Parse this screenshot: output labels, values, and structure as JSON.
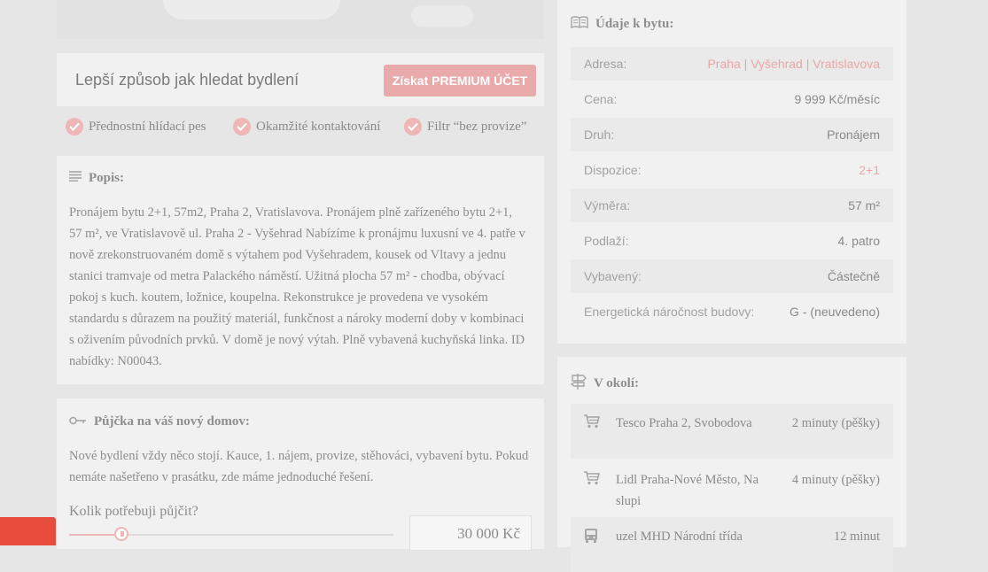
{
  "premium": {
    "title": "Lepší způsob jak hledat bydlení",
    "button": "Získat PREMIUM ÚČET",
    "features": [
      "Přednostní hlídací pes",
      "Okamžité kontaktování",
      "Filtr “bez provize”"
    ]
  },
  "popis": {
    "heading": "Popis:",
    "text": "Pronájem bytu 2+1, 57m2, Praha 2, Vratislavova. Pronájem plně zařízeného bytu 2+1, 57 m², ve Vratislavově ul. Praha 2 - Vyšehrad Nabízíme k pronájmu luxusní ve 4. patře v nově zrekonstruovaném domě s výtahem pod Vyšehradem, kousek od Vltavy a jednu stanici tramvaje od metra Palackého náměstí. Užitná plocha 57 m² - chodba, obývací pokoj s kuch. koutem, ložnice, koupelna. Rekonstrukce je provedena ve vysokém standardu s důrazem na použitý materiál, funkčnost a nároky moderní doby v kombinaci s oživením původních prvků. V domě je nový výtah. Plně vybavená kuchyňská linka. ID nabídky: N00043."
  },
  "loan": {
    "heading": "Půjčka na váš nový domov:",
    "text": "Nové bydlení vždy něco stojí. Kauce, 1. nájem, provize, stěhováci, vybavení bytu. Pokud nemáte našetřeno v prasátku, zde máme jednoduché řešení.",
    "question": "Kolik potřebuji půjčit?",
    "amount": "30 000 Kč",
    "slider_fraction": 0.16
  },
  "udaje": {
    "heading": "Údaje k bytu:",
    "rows": [
      {
        "label": "Adresa:",
        "value": "Praha | Vyšehrad | Vratislavova"
      },
      {
        "label": "Cena:",
        "value": "9 999 Kč/měsíc"
      },
      {
        "label": "Druh:",
        "value": "Pronájem"
      },
      {
        "label": "Dispozice:",
        "value": "2+1"
      },
      {
        "label": "Výměra:",
        "value": "57 m²"
      },
      {
        "label": "Podlaží:",
        "value": "4. patro"
      },
      {
        "label": "Vybavený:",
        "value": "Částečně"
      },
      {
        "label": "Energetická náročnost budovy:",
        "value": "G - (neuvedeno)"
      }
    ]
  },
  "okoli": {
    "heading": "V okolí:",
    "items": [
      {
        "icon": "cart-icon",
        "name": "Tesco Praha 2, Svobodova",
        "time": "2 minuty (pěšky)"
      },
      {
        "icon": "cart-icon",
        "name": "Lidl Praha-Nové Město, Na slupi",
        "time": "4 minuty (pěšky)"
      },
      {
        "icon": "bus-icon",
        "name": "uzel MHD Národní třída",
        "time": "12 minut"
      }
    ]
  },
  "colors": {
    "accent": "#e8aaaa",
    "accent_light": "#efb6b6",
    "red_tab": "#e74c3c"
  }
}
